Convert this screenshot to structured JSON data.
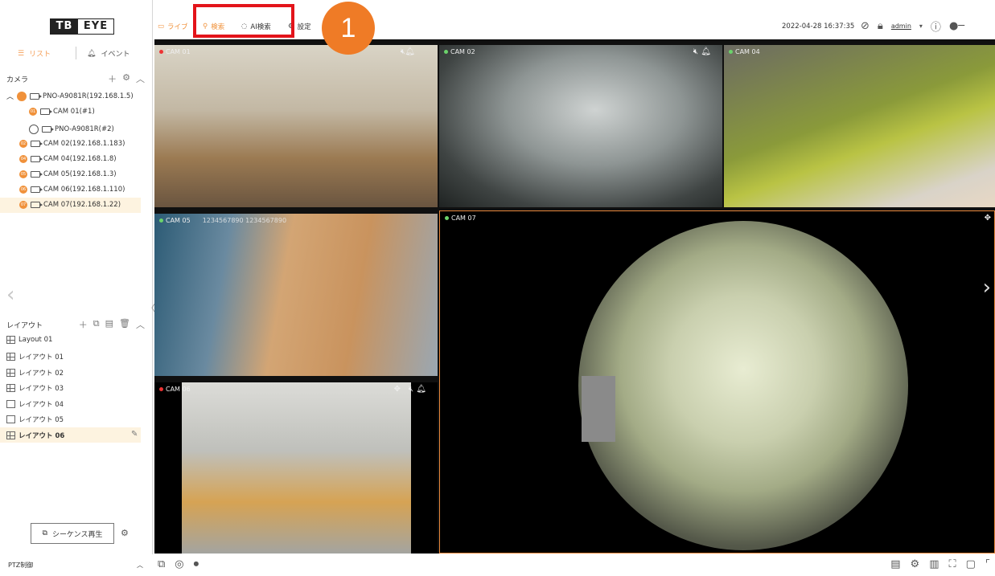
{
  "app": {
    "logo_part1": "TB",
    "logo_part2": "EYE"
  },
  "topbar": {
    "menu": {
      "live": "ライブ",
      "search": "検索",
      "ai_search": "AI検索",
      "settings": "設定"
    },
    "datetime": "2022-04-28 16:37:35",
    "user": "admin",
    "callout_number": "1"
  },
  "sidebar": {
    "tab_list": "リスト",
    "tab_event": "イベント",
    "camera_header": "カメラ",
    "camera_tree": [
      {
        "label": "PNO-A9081R(192.168.1.5)",
        "badge": ""
      },
      {
        "label": "CAM 01(#1)",
        "badge": "01"
      },
      {
        "label": "PNO-A9081R(#2)",
        "badge": ""
      },
      {
        "label": "CAM 02(192.168.1.183)",
        "badge": "02"
      },
      {
        "label": "CAM 04(192.168.1.8)",
        "badge": "04"
      },
      {
        "label": "CAM 05(192.168.1.3)",
        "badge": "05"
      },
      {
        "label": "CAM 06(192.168.1.110)",
        "badge": "06"
      },
      {
        "label": "CAM 07(192.168.1.22)",
        "badge": "07"
      }
    ],
    "layout_header": "レイアウト",
    "layouts": [
      "Layout 01",
      "レイアウト 01",
      "レイアウト 02",
      "レイアウト 03",
      "レイアウト 04",
      "レイアウト 05",
      "レイアウト 06"
    ],
    "sequence_button": "シーケンス再生",
    "ptz_label": "PTZ制御"
  },
  "cameras": {
    "cam1": "CAM 01",
    "cam2": "CAM 02",
    "cam3": "CAM 04",
    "cam5": "CAM 05",
    "cam5_overlay": "1234567890 1234567890",
    "cam6": "CAM 06",
    "cam7": "CAM 07"
  },
  "colors": {
    "accent": "#f0913a",
    "highlight_box": "#e3141a",
    "callout": "#ef7b26",
    "selected_row": "#fdf3e0"
  }
}
